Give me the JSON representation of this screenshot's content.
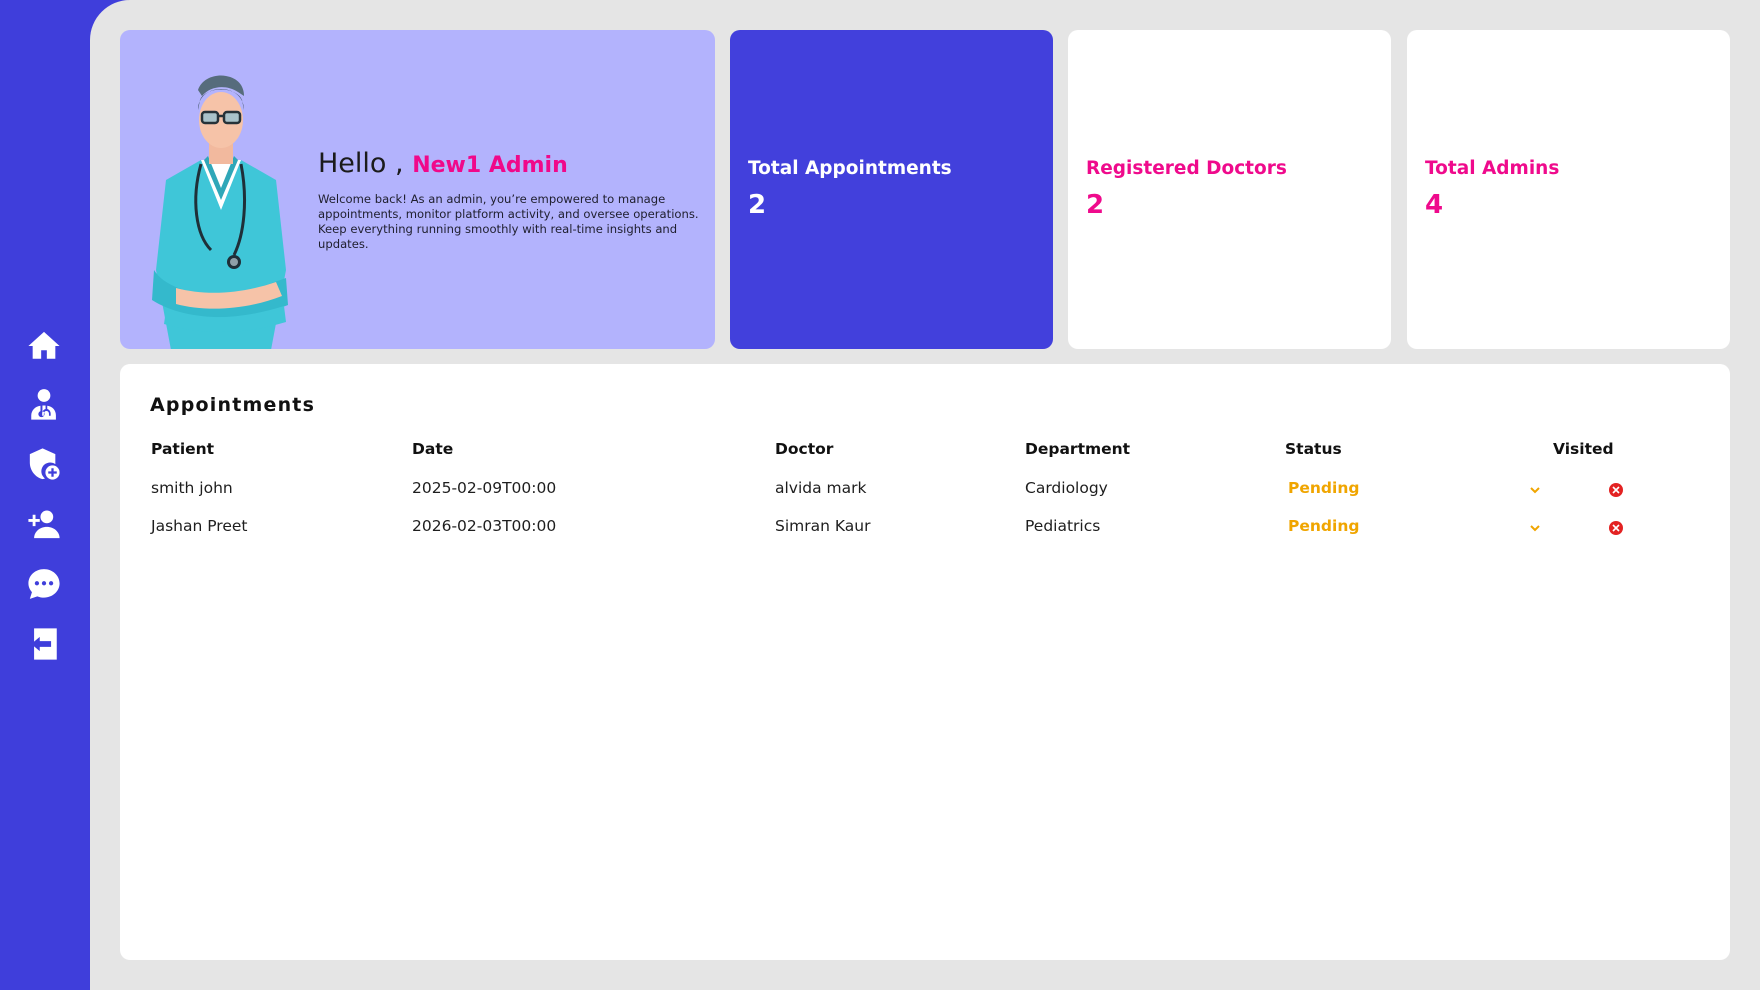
{
  "sidebar": {
    "items": [
      {
        "icon": "home-icon"
      },
      {
        "icon": "doctor-icon"
      },
      {
        "icon": "shield-plus-icon"
      },
      {
        "icon": "add-user-icon"
      },
      {
        "icon": "chat-icon"
      },
      {
        "icon": "logout-icon"
      }
    ]
  },
  "hero": {
    "greeting": "Hello ,",
    "name": "New1 Admin",
    "description": "Welcome back! As an admin, you’re empowered to manage appointments, monitor platform activity, and oversee operations. Keep everything running smoothly with real-time insights and updates."
  },
  "stats": [
    {
      "title": "Total Appointments",
      "value": "2"
    },
    {
      "title": "Registered Doctors",
      "value": "2"
    },
    {
      "title": "Total Admins",
      "value": "4"
    }
  ],
  "appointments": {
    "title": "Appointments",
    "columns": [
      "Patient",
      "Date",
      "Doctor",
      "Department",
      "Status",
      "Visited"
    ],
    "rows": [
      {
        "patient": "smith john",
        "date": "2025-02-09T00:00",
        "doctor": "alvida mark",
        "department": "Cardiology",
        "status": "Pending"
      },
      {
        "patient": "Jashan Preet",
        "date": "2026-02-03T00:00",
        "doctor": "Simran Kaur",
        "department": "Pediatrics",
        "status": "Pending"
      }
    ]
  },
  "colors": {
    "brand": "#3f3edb",
    "accent": "#ef0a8c",
    "status_pending": "#f0a500",
    "hero_bg": "#b3b3fd"
  }
}
